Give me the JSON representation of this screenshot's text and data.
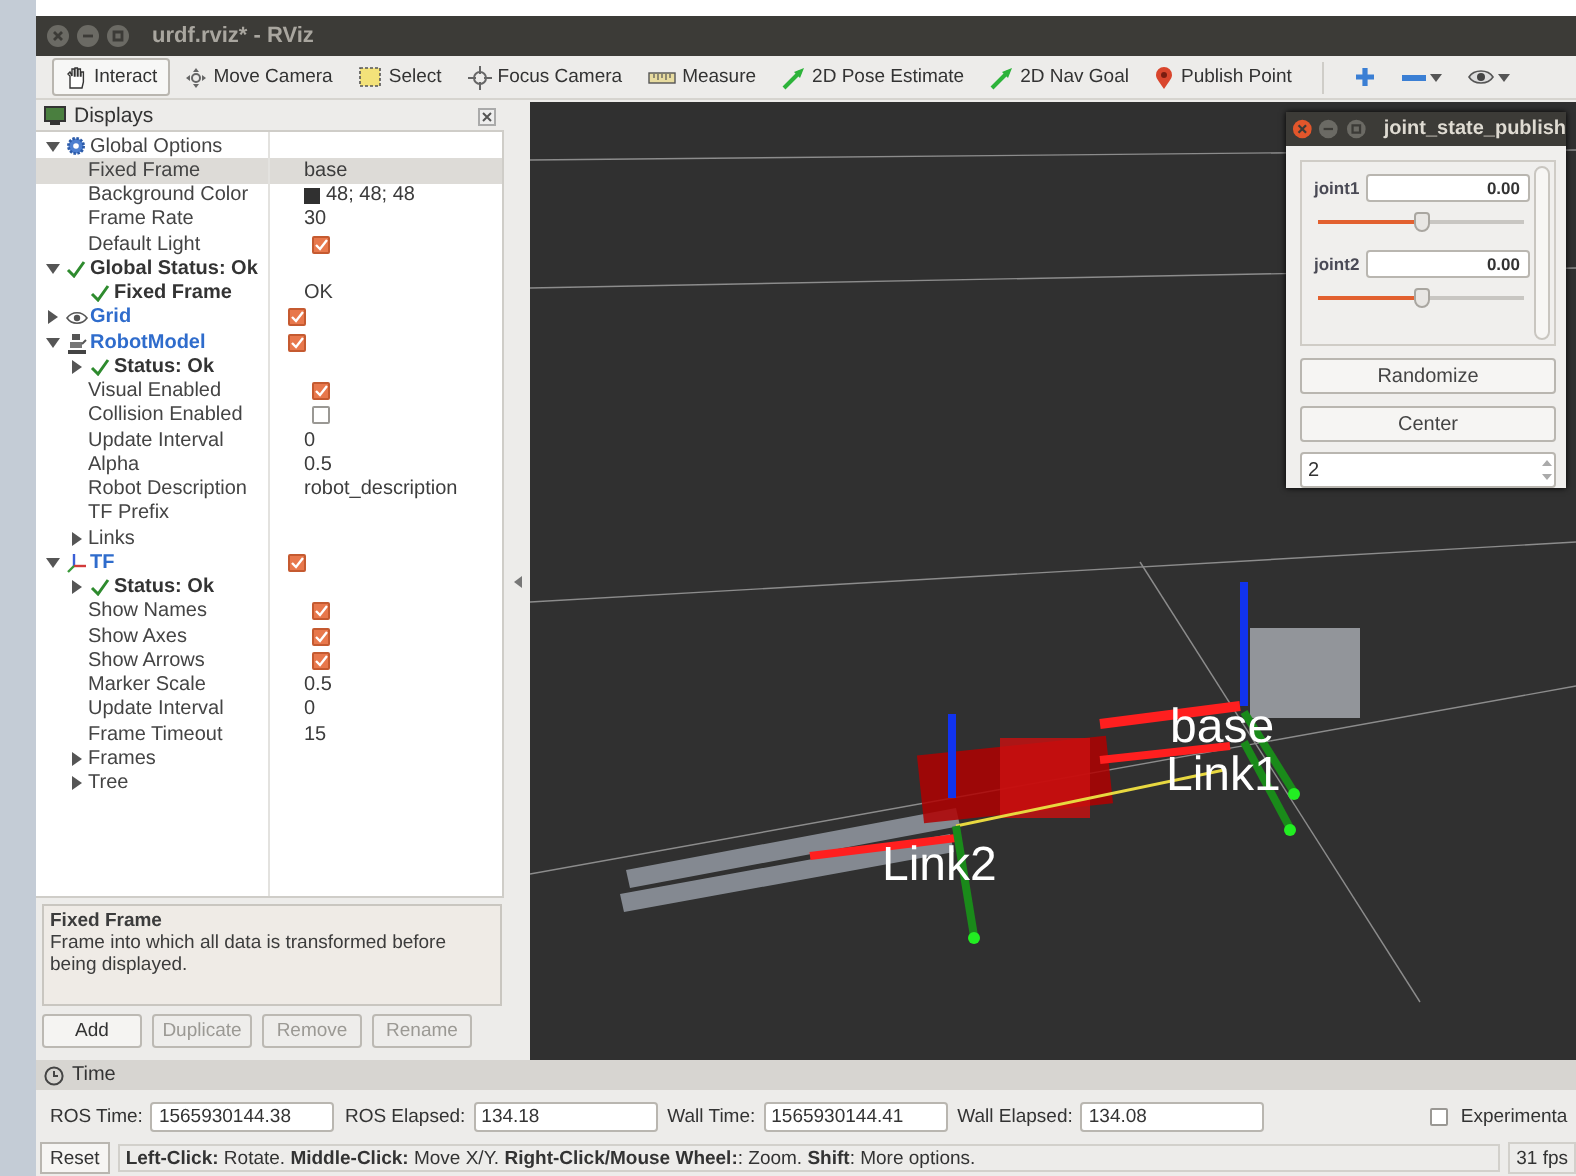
{
  "window": {
    "title": "urdf.rviz* - RViz"
  },
  "toolbar": {
    "tools": [
      {
        "label": "Interact",
        "selected": true
      },
      {
        "label": "Move Camera",
        "selected": false
      },
      {
        "label": "Select",
        "selected": false
      },
      {
        "label": "Focus Camera",
        "selected": false
      },
      {
        "label": "Measure",
        "selected": false
      },
      {
        "label": "2D Pose Estimate",
        "selected": false
      },
      {
        "label": "2D Nav Goal",
        "selected": false
      },
      {
        "label": "Publish Point",
        "selected": false
      }
    ]
  },
  "displays": {
    "title": "Displays",
    "tree": [
      {
        "label": "Global Options",
        "kind": "group",
        "expanded": true,
        "selected": false,
        "children": [
          {
            "label": "Fixed Frame",
            "kind": "property",
            "value": "base",
            "selected": true
          },
          {
            "label": "Background Color",
            "kind": "property",
            "value": "48; 48; 48",
            "color": "#303030",
            "selected": false
          },
          {
            "label": "Frame Rate",
            "kind": "property",
            "value": "30",
            "selected": false
          },
          {
            "label": "Default Light",
            "kind": "property",
            "checked": true,
            "selected": false
          }
        ]
      },
      {
        "label": "Global Status: Ok",
        "kind": "status",
        "expanded": true,
        "selected": false,
        "children": [
          {
            "label": "Fixed Frame",
            "kind": "status",
            "value": "OK",
            "selected": false
          }
        ]
      },
      {
        "label": "Grid",
        "kind": "display",
        "expanded": false,
        "checked": true,
        "selected": false
      },
      {
        "label": "RobotModel",
        "kind": "display",
        "expanded": true,
        "checked": true,
        "selected": false,
        "children": [
          {
            "label": "Status: Ok",
            "kind": "status",
            "expanded": false,
            "selected": false
          },
          {
            "label": "Visual Enabled",
            "kind": "property",
            "checked": true,
            "selected": false
          },
          {
            "label": "Collision Enabled",
            "kind": "property",
            "checked": false,
            "selected": false
          },
          {
            "label": "Update Interval",
            "kind": "property",
            "value": "0",
            "selected": false
          },
          {
            "label": "Alpha",
            "kind": "property",
            "value": "0.5",
            "selected": false
          },
          {
            "label": "Robot Description",
            "kind": "property",
            "value": "robot_description",
            "selected": false
          },
          {
            "label": "TF Prefix",
            "kind": "property",
            "selected": false
          },
          {
            "label": "Links",
            "kind": "property",
            "expanded": false,
            "selected": false
          }
        ]
      },
      {
        "label": "TF",
        "kind": "display",
        "expanded": true,
        "checked": true,
        "selected": false,
        "children": [
          {
            "label": "Status: Ok",
            "kind": "status",
            "expanded": false,
            "selected": false
          },
          {
            "label": "Show Names",
            "kind": "property",
            "checked": true,
            "selected": false
          },
          {
            "label": "Show Axes",
            "kind": "property",
            "checked": true,
            "selected": false
          },
          {
            "label": "Show Arrows",
            "kind": "property",
            "checked": true,
            "selected": false
          },
          {
            "label": "Marker Scale",
            "kind": "property",
            "value": "0.5",
            "selected": false
          },
          {
            "label": "Update Interval",
            "kind": "property",
            "value": "0",
            "selected": false
          },
          {
            "label": "Frame Timeout",
            "kind": "property",
            "value": "15",
            "selected": false
          },
          {
            "label": "Frames",
            "kind": "property",
            "expanded": false,
            "selected": false
          },
          {
            "label": "Tree",
            "kind": "property",
            "expanded": false,
            "selected": false
          }
        ]
      }
    ],
    "help": {
      "title": "Fixed Frame",
      "text": "Frame into which all data is transformed before being displayed."
    },
    "buttons": [
      {
        "label": "Add",
        "disabled": false
      },
      {
        "label": "Duplicate",
        "disabled": true
      },
      {
        "label": "Remove",
        "disabled": true
      },
      {
        "label": "Rename",
        "disabled": true
      }
    ]
  },
  "viewport": {
    "labels": [
      {
        "text": "base"
      },
      {
        "text": "Link1"
      },
      {
        "text": "Link2"
      }
    ]
  },
  "joint_window": {
    "title": "joint_state_publish",
    "joints": [
      {
        "name": "joint1",
        "value": "0.00",
        "level": 0.5
      },
      {
        "name": "joint2",
        "value": "0.00",
        "level": 0.5
      }
    ],
    "buttons": [
      "Randomize",
      "Center"
    ],
    "spin_value": "2"
  },
  "time": {
    "title": "Time",
    "fields": [
      {
        "label": "ROS Time:",
        "value": "1565930144.38"
      },
      {
        "label": "ROS Elapsed:",
        "value": "134.18"
      },
      {
        "label": "Wall Time:",
        "value": "1565930144.41"
      },
      {
        "label": "Wall Elapsed:",
        "value": "134.08"
      }
    ],
    "experimental": {
      "label": "Experimenta",
      "checked": false
    }
  },
  "status_bar": {
    "reset": "Reset",
    "hint": "**Left-Click:** Rotate. **Middle-Click:** Move X/Y. **Right-Click/Mouse Wheel:**: Zoom. **Shift**: More options.",
    "fps": "31 fps"
  }
}
